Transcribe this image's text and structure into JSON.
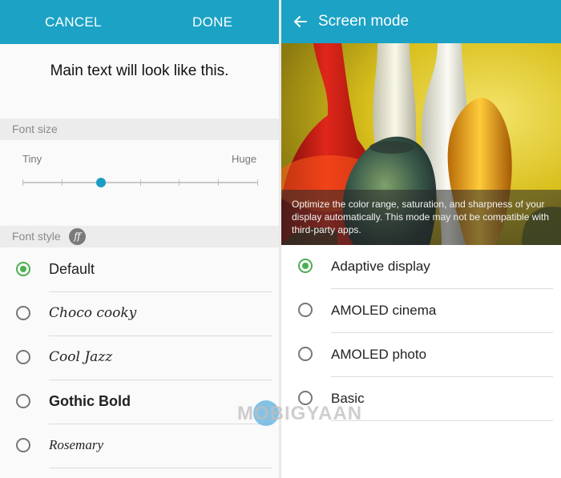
{
  "left": {
    "cancel_label": "CANCEL",
    "done_label": "DONE",
    "preview_text": "Main text will look like this.",
    "font_size": {
      "header": "Font size",
      "min_label": "Tiny",
      "max_label": "Huge",
      "steps": 7,
      "selected_step": 2
    },
    "font_style": {
      "header": "Font style",
      "icon": "ff-icon",
      "options": [
        {
          "label": "Default",
          "selected": true
        },
        {
          "label": "Choco cooky",
          "selected": false
        },
        {
          "label": "Cool Jazz",
          "selected": false
        },
        {
          "label": "Gothic Bold",
          "selected": false
        },
        {
          "label": "Rosemary",
          "selected": false
        }
      ]
    }
  },
  "right": {
    "title": "Screen mode",
    "back_icon": "arrow-back-icon",
    "description": "Optimize the color range, saturation, and sharpness of your display automatically. This mode may not be compatible with third-party apps.",
    "options": [
      {
        "label": "Adaptive display",
        "selected": true
      },
      {
        "label": "AMOLED cinema",
        "selected": false
      },
      {
        "label": "AMOLED photo",
        "selected": false
      },
      {
        "label": "Basic",
        "selected": false
      }
    ]
  },
  "watermark": "MOBIGYAAN",
  "colors": {
    "app_bar": "#1ba2c4",
    "accent_radio": "#4caf50",
    "slider_thumb": "#1a9cc6"
  }
}
